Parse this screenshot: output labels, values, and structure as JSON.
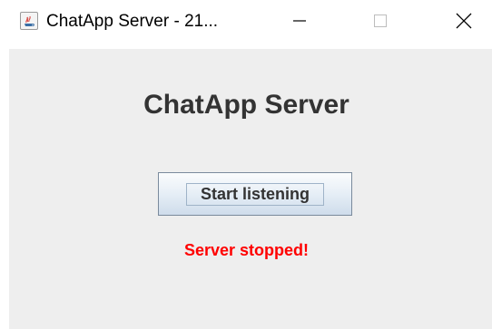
{
  "window": {
    "title": "ChatApp Server - 21...",
    "app_icon": "java-icon",
    "controls": {
      "minimize_icon": "minimize-icon",
      "maximize_icon": "maximize-icon",
      "close_icon": "close-icon"
    }
  },
  "main": {
    "heading": "ChatApp Server",
    "start_button_label": "Start listening",
    "status_text": "Server stopped!"
  },
  "colors": {
    "panel_background": "#eeeeee",
    "heading_color": "#333333",
    "status_color": "#ff0000"
  }
}
